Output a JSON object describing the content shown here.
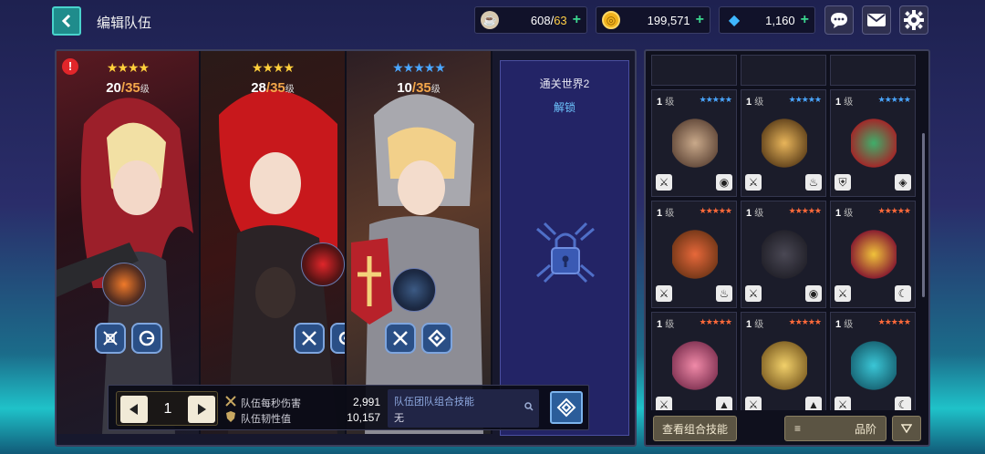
{
  "header": {
    "title": "编辑队伍",
    "stamina": {
      "current": "608",
      "max": "63"
    },
    "gold": "199,571",
    "gems": "1,160"
  },
  "team": {
    "heroes": [
      {
        "level": "20",
        "max_level": "35",
        "unit": "级",
        "stars": "★★★★",
        "warning": "!"
      },
      {
        "level": "28",
        "max_level": "35",
        "unit": "级",
        "stars": "★★★★"
      },
      {
        "level": "10",
        "max_level": "35",
        "unit": "级",
        "stars": "★★★★★"
      }
    ],
    "locked_slot": {
      "title": "通关世界2",
      "subtitle": "解锁"
    }
  },
  "bottom_bar": {
    "page": "1",
    "dps_label": "队伍每秒伤害",
    "dps_value": "2,991",
    "toughness_label": "队伍韧性值",
    "toughness_value": "10,157",
    "combo_title": "队伍团队组合技能",
    "combo_value": "无"
  },
  "roster": {
    "cards": [
      {
        "level": "1",
        "unit": "级",
        "stars": "★★★★★",
        "star_color": "#4aa6ff",
        "sprite_color": "#c9a98a",
        "skill_left": "⚔",
        "skill_right": "◉"
      },
      {
        "level": "1",
        "unit": "级",
        "stars": "★★★★★",
        "star_color": "#4aa6ff",
        "sprite_color": "#e8b55a",
        "skill_left": "⚔",
        "skill_right": "♨"
      },
      {
        "level": "1",
        "unit": "级",
        "stars": "★★★★★",
        "star_color": "#4aa6ff",
        "sprite_color": "#3fae6a",
        "skill_left": "⛨",
        "skill_right": "◈"
      },
      {
        "level": "1",
        "unit": "级",
        "stars": "★★★★★",
        "star_color": "#ff6a3a",
        "sprite_color": "#e7683a",
        "skill_left": "⚔",
        "skill_right": "♨"
      },
      {
        "level": "1",
        "unit": "级",
        "stars": "★★★★★",
        "star_color": "#ff6a3a",
        "sprite_color": "#33323c",
        "skill_left": "⚔",
        "skill_right": "◉"
      },
      {
        "level": "1",
        "unit": "级",
        "stars": "★★★★★",
        "star_color": "#ff6a3a",
        "sprite_color": "#f0c23a",
        "skill_left": "⚔",
        "skill_right": "☾"
      },
      {
        "level": "1",
        "unit": "级",
        "stars": "★★★★★",
        "star_color": "#ff6a3a",
        "sprite_color": "#f08aa8",
        "skill_left": "⚔",
        "skill_right": "▲"
      },
      {
        "level": "1",
        "unit": "级",
        "stars": "★★★★★",
        "star_color": "#ff6a3a",
        "sprite_color": "#f1d06a",
        "skill_left": "⚔",
        "skill_right": "▲"
      },
      {
        "level": "1",
        "unit": "级",
        "stars": "★★★★★",
        "star_color": "#ff6a3a",
        "sprite_color": "#3ac6d6",
        "skill_left": "⚔",
        "skill_right": "☾"
      }
    ],
    "view_combo_label": "查看组合技能",
    "sort_label": "品阶"
  }
}
